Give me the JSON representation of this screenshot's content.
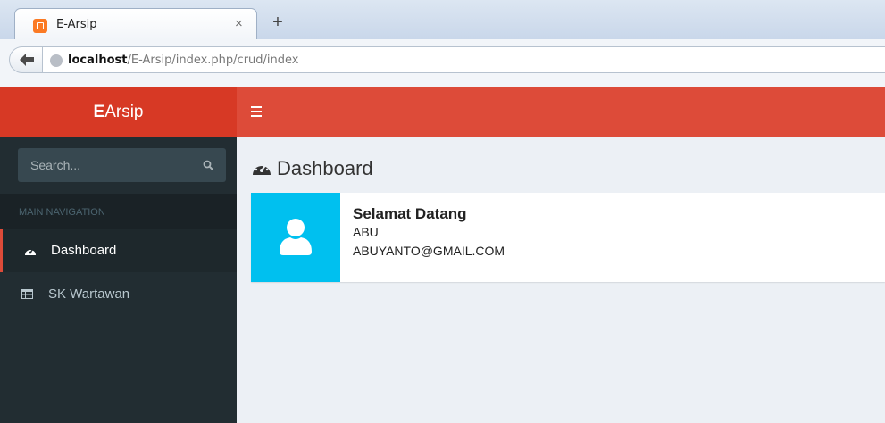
{
  "browser": {
    "tab_title": "E-Arsip",
    "tab_close": "×",
    "new_tab": "+",
    "url_host": "localhost",
    "url_path": "/E-Arsip/index.php/crud/index"
  },
  "app": {
    "logo_bold": "E",
    "logo_rest": "Arsip",
    "brand_color": "#dd4b39",
    "sidebar_color": "#222d32"
  },
  "sidebar": {
    "search_placeholder": "Search...",
    "nav_header": "MAIN NAVIGATION",
    "items": [
      {
        "label": "Dashboard",
        "icon": "dashboard-icon",
        "active": true
      },
      {
        "label": "SK Wartawan",
        "icon": "table-icon",
        "active": false
      }
    ]
  },
  "content": {
    "page_title": "Dashboard",
    "info_box": {
      "icon": "user-icon",
      "color": "#00c0ef",
      "title": "Selamat Datang",
      "line1": "ABU",
      "line2": "ABUYANTO@GMAIL.COM"
    }
  }
}
